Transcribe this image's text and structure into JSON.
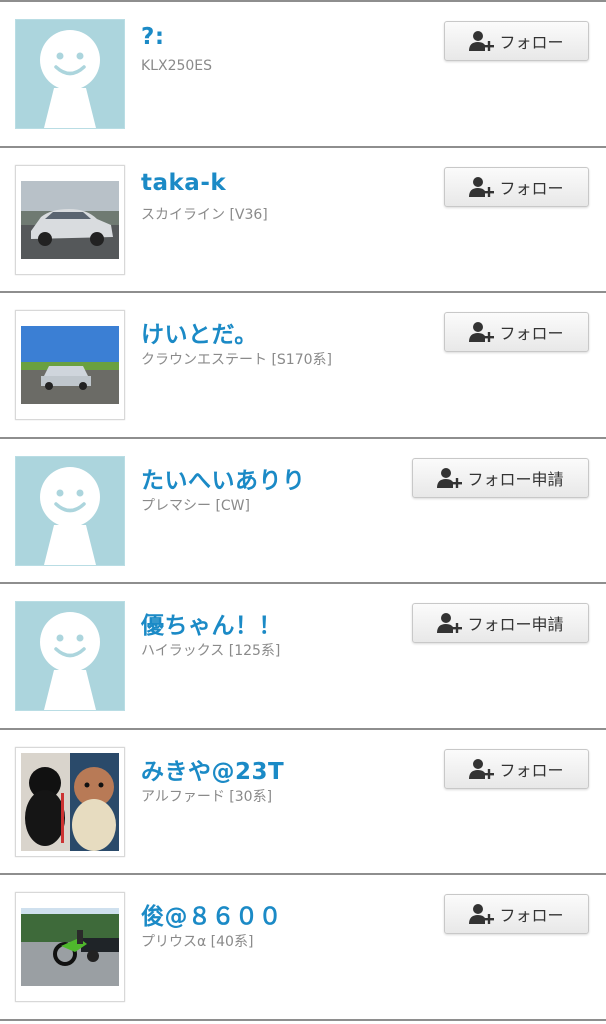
{
  "users": [
    {
      "name": "?:",
      "vehicle": "KLX250ES",
      "button": "フォロー",
      "avatar": "default-person-icon"
    },
    {
      "name": "taka-k",
      "vehicle": "スカイライン [V36]",
      "button": "フォロー",
      "avatar": "silver-sedan-photo"
    },
    {
      "name": "けいとだ。",
      "vehicle": "クラウンエステート [S170系]",
      "button": "フォロー",
      "avatar": "silver-wagon-photo"
    },
    {
      "name": "たいへいありり",
      "vehicle": "プレマシー [CW]",
      "button": "フォロー申請",
      "avatar": "default-person-icon"
    },
    {
      "name": "優ちゃん！！",
      "vehicle": "ハイラックス [125系]",
      "button": "フォロー申請",
      "avatar": "default-person-icon"
    },
    {
      "name": "みきや@23T",
      "vehicle": "アルファード [30系]",
      "button": "フォロー",
      "avatar": "dogs-photo"
    },
    {
      "name": "俊@８６００",
      "vehicle": "プリウスα [40系]",
      "button": "フォロー",
      "avatar": "motorcycle-photo"
    }
  ],
  "colors": {
    "name": "#1b8ac6",
    "subtext": "#8a8a8a",
    "default_avatar_bg": "#acd5dd",
    "divider": "#8e8e8e"
  }
}
